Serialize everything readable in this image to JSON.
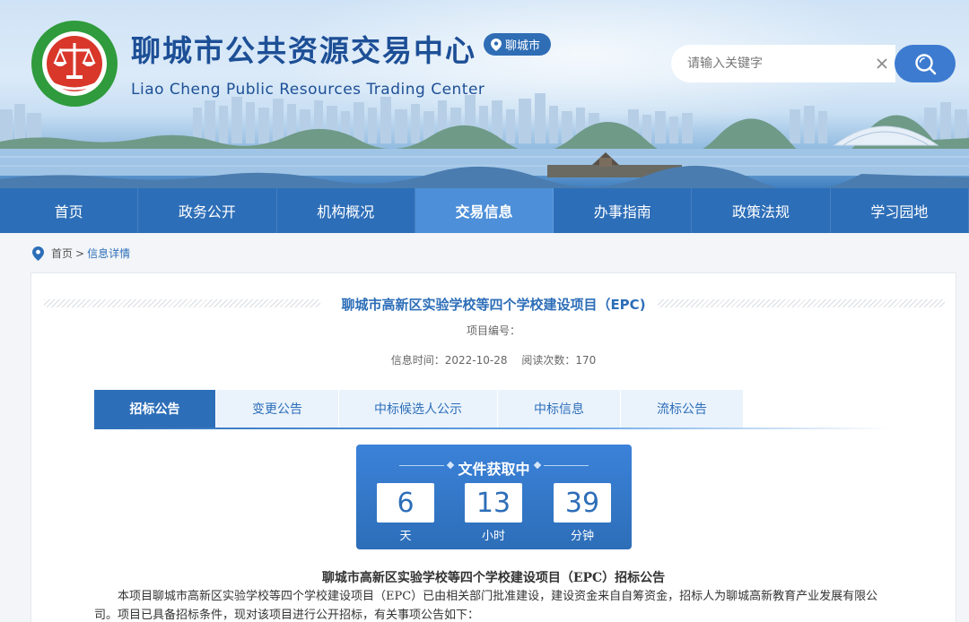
{
  "header": {
    "title": "聊城市公共资源交易中心",
    "subtitle": "Liao Cheng Public Resources Trading Center",
    "city_badge": "聊城市",
    "search_placeholder": "请输入关键字",
    "colors": {
      "primary": "#2d6eb8",
      "active_nav": "#4d8fd8",
      "title": "#1d4f96"
    }
  },
  "nav": {
    "items": [
      {
        "label": "首页"
      },
      {
        "label": "政务公开"
      },
      {
        "label": "机构概况"
      },
      {
        "label": "交易信息",
        "active": true
      },
      {
        "label": "办事指南"
      },
      {
        "label": "政策法规"
      },
      {
        "label": "学习园地"
      }
    ]
  },
  "breadcrumb": {
    "home": "首页",
    "separator": ">",
    "current": "信息详情"
  },
  "article": {
    "title": "聊城市高新区实验学校等四个学校建设项目（EPC)",
    "project_no_label": "项目编号：",
    "info_time": "信息时间：2022-10-28",
    "read_count": "阅读次数：170"
  },
  "tabs": [
    {
      "label": "招标公告",
      "active": true
    },
    {
      "label": "变更公告"
    },
    {
      "label": "中标候选人公示"
    },
    {
      "label": "中标信息"
    },
    {
      "label": "流标公告"
    }
  ],
  "countdown": {
    "title": "文件获取中",
    "days": "6",
    "days_label": "天",
    "hours": "13",
    "hours_label": "小时",
    "minutes": "39",
    "minutes_label": "分钟"
  },
  "body": {
    "title": "聊城市高新区实验学校等四个学校建设项目（EPC）招标公告",
    "paragraph": "本项目聊城市高新区实验学校等四个学校建设项目（EPC）已由相关部门批准建设，建设资金来自自筹资金，招标人为聊城高新教育产业发展有限公司。项目已具备招标条件，现对该项目进行公开招标，有关事项公告如下："
  }
}
